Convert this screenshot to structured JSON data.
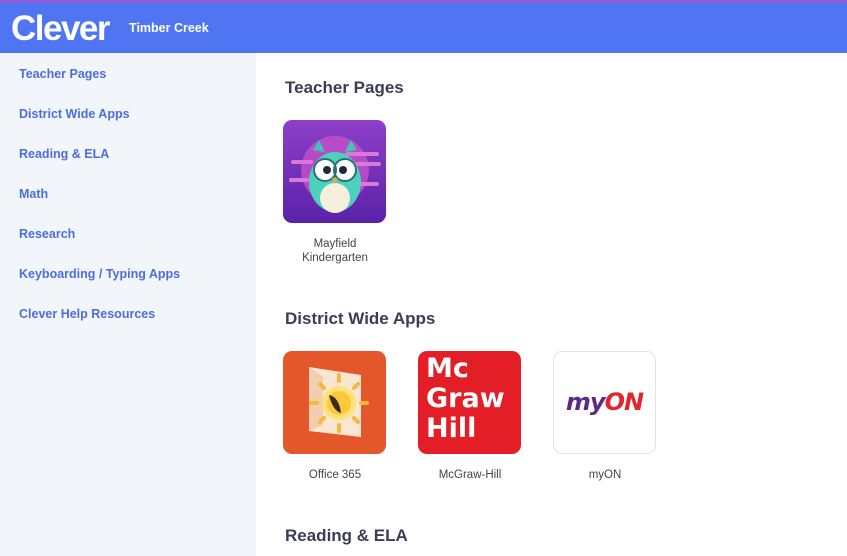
{
  "header": {
    "logo": "Clever",
    "district": "Timber Creek",
    "color": "#4f75f2"
  },
  "sidebar": {
    "items": [
      {
        "label": "Teacher Pages"
      },
      {
        "label": "District Wide Apps"
      },
      {
        "label": "Reading & ELA"
      },
      {
        "label": "Math"
      },
      {
        "label": "Research"
      },
      {
        "label": "Keyboarding / Typing Apps"
      },
      {
        "label": "Clever Help Resources"
      }
    ]
  },
  "sections": [
    {
      "title": "Teacher Pages",
      "apps": [
        {
          "label": "Mayfield Kindergarten",
          "icon": "owl-icon"
        }
      ]
    },
    {
      "title": "District Wide Apps",
      "apps": [
        {
          "label": "Office 365",
          "icon": "office-365-icon"
        },
        {
          "label": "McGraw-Hill",
          "icon": "mcgraw-hill-icon",
          "icon_text": [
            "Mc",
            "Graw",
            "Hill"
          ]
        },
        {
          "label": "myON",
          "icon": "myon-icon",
          "icon_text": [
            "my",
            "ON"
          ]
        }
      ]
    },
    {
      "title": "Reading & ELA",
      "apps": []
    }
  ]
}
